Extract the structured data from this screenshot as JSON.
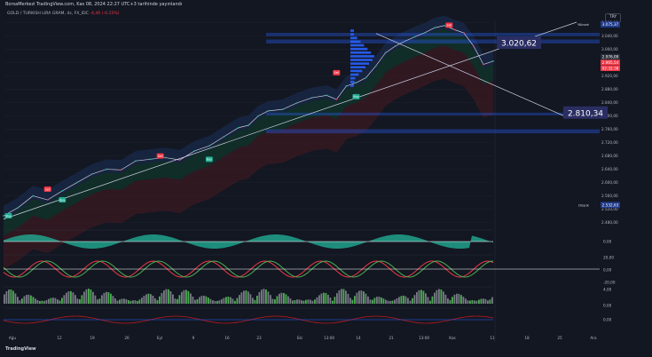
{
  "header": {
    "title": "BorsaMerkezi TradingView.com, Kas 08, 2024 22:27 UTC+3 tarihinde yayınlandı",
    "symbol": "GOLD / TURKISH LIRA GRAM, 4s, FX_IDC",
    "change": "-4,46 (-0,15%)",
    "currency_button": "TRY"
  },
  "footer": {
    "brand": "TradingView"
  },
  "colors": {
    "background": "#131722",
    "up": "#22ab94",
    "down": "#f23645",
    "trendline": "#cfd3e6",
    "highlight_label": "#2a2e62",
    "volume_profile": "#2962ff"
  },
  "chart_data": [
    {
      "type": "line",
      "title": "GOLD / TURKISH LIRA GRAM, 4s, FX_IDC",
      "x_ticks": [
        "Ağu",
        "12",
        "19",
        "26",
        "Eyl",
        "9",
        "16",
        "23",
        "Eki",
        "13:00",
        "14",
        "21",
        "13:00",
        "Kas",
        "11",
        "18",
        "25",
        "Ara"
      ],
      "y_ticks": [
        2480,
        2520,
        2560,
        2600,
        2640,
        2680,
        2720,
        2760,
        2800,
        2840,
        2880,
        2920,
        2960,
        3000,
        3040,
        3080
      ],
      "y_tick_labels": [
        "2.480,00",
        "2.520,00",
        "2.560,00",
        "2.600,00",
        "2.640,00",
        "2.680,00",
        "2.720,00",
        "2.760,00",
        "2.800,00",
        "2.840,00",
        "2.880,00",
        "2.920,00",
        "2.960,00",
        "3.000,00",
        "3.040,00",
        "3.080,00"
      ],
      "ylim": [
        2460,
        3090
      ],
      "series": [
        {
          "x": [
            0,
            3,
            6,
            9,
            12,
            15,
            18,
            21,
            24,
            27,
            30,
            33,
            36,
            39,
            42,
            45,
            48,
            50,
            52,
            54,
            57,
            60,
            63,
            66,
            68,
            70,
            72,
            74,
            76,
            78,
            80,
            82,
            84,
            86,
            88,
            90,
            92,
            94,
            96,
            98,
            100
          ],
          "values": [
            2500,
            2525,
            2560,
            2548,
            2575,
            2600,
            2625,
            2640,
            2638,
            2665,
            2670,
            2675,
            2668,
            2695,
            2710,
            2738,
            2765,
            2772,
            2800,
            2815,
            2820,
            2840,
            2855,
            2862,
            2850,
            2890,
            2900,
            2915,
            2950,
            2990,
            3010,
            3025,
            3038,
            3050,
            3065,
            3072,
            3060,
            3050,
            3010,
            2955,
            2965
          ]
        }
      ],
      "signals": [
        {
          "label": "Sell",
          "x": 9,
          "y": 2580
        },
        {
          "label": "Buy",
          "x": 1,
          "y": 2500
        },
        {
          "label": "Buy",
          "x": 12,
          "y": 2548
        },
        {
          "label": "Sell",
          "x": 32,
          "y": 2680
        },
        {
          "label": "Buy",
          "x": 42,
          "y": 2670
        },
        {
          "label": "Sell",
          "x": 68,
          "y": 2930
        },
        {
          "label": "Buy",
          "x": 72,
          "y": 2858
        },
        {
          "label": "Sell",
          "x": 91,
          "y": 3073
        }
      ],
      "annotations": [
        {
          "label": "Yüksek",
          "value": 3075.37,
          "text": "3.075,37"
        },
        {
          "label": "Düşük",
          "value": 2532.63,
          "text": "2.532,63"
        },
        {
          "text": "3.020,62",
          "value": 3020.62
        },
        {
          "text": "2.810,34",
          "value": 2810.34
        }
      ],
      "price_labels": [
        {
          "text": "2.976,09",
          "color": "#2a2e39"
        },
        {
          "text": "2.965,54",
          "color": "#f23645"
        },
        {
          "text": "02:32:38",
          "color": "#f23645"
        }
      ]
    },
    {
      "type": "area",
      "title": "",
      "y_ticks": [
        0
      ],
      "y_tick_labels": [
        "0,00"
      ]
    },
    {
      "type": "line",
      "title": "",
      "y_ticks": [
        20,
        0,
        -20
      ],
      "y_tick_labels": [
        "20,00",
        "0,00",
        "-20,00"
      ]
    },
    {
      "type": "bar",
      "title": "",
      "y_ticks": [
        4,
        0
      ],
      "y_tick_labels": [
        "4,00",
        "0,00"
      ]
    },
    {
      "type": "line",
      "title": "",
      "y_ticks": [
        0
      ],
      "y_tick_labels": [
        "0,00"
      ]
    }
  ]
}
